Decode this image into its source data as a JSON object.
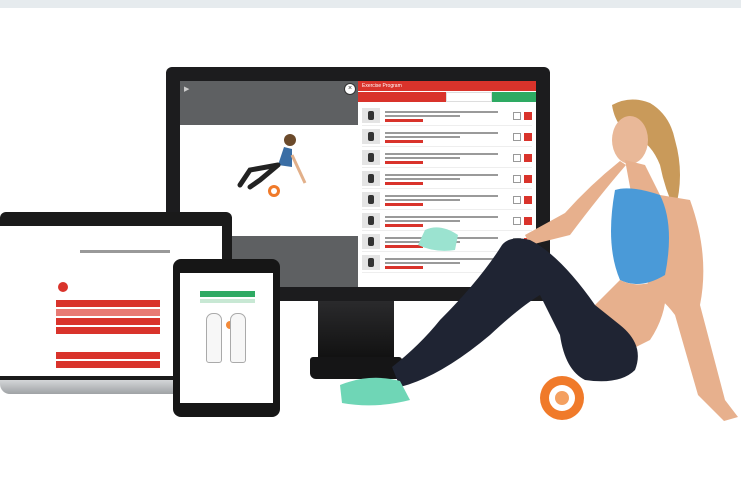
{
  "devices": {
    "monitor": {
      "list_header_title": "Exercise Program",
      "close_label": "×",
      "tabs": [
        {
          "label": "",
          "color": "#d9332b"
        },
        {
          "label": "",
          "color": "#d9332b"
        },
        {
          "label": "",
          "color": "#ffffff"
        },
        {
          "label": "",
          "color": "#2eaa63"
        }
      ],
      "exercise_count": 8,
      "play_label": "▶"
    },
    "laptop": {
      "logo_text": "",
      "rows_count": 6
    },
    "tablet": {
      "tab_active": "",
      "tab_inactive": ""
    }
  },
  "colors": {
    "accent_red": "#d9332b",
    "accent_green": "#2eaa63",
    "roller_orange": "#f07a2a",
    "top_band": "#e6ebee"
  }
}
